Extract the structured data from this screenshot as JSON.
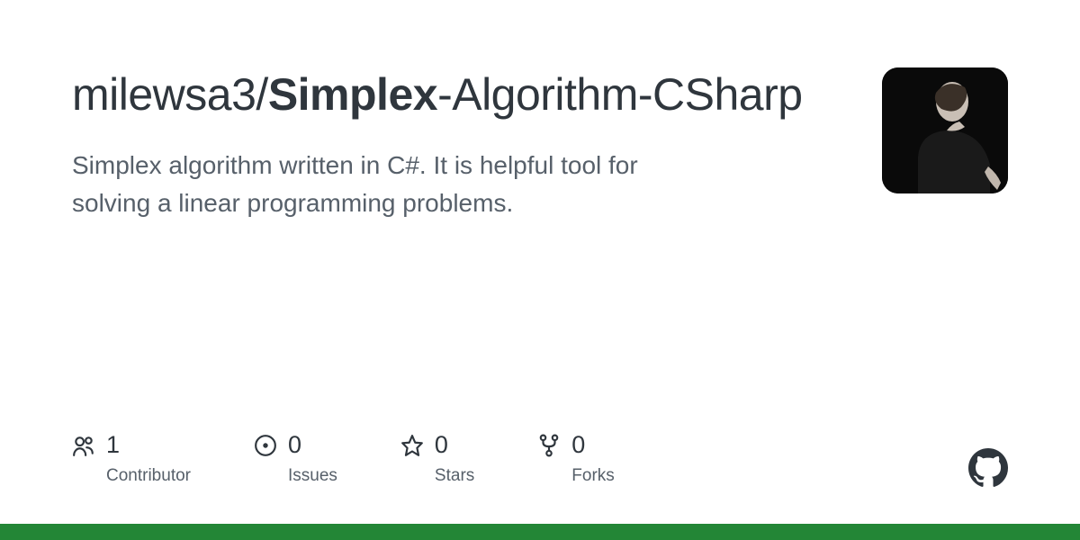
{
  "repo": {
    "owner": "milewsa3",
    "separator": "/",
    "name_bold": "Simplex",
    "name_rest": "-Algorithm-CSharp"
  },
  "description": "Simplex algorithm written in C#. It is helpful tool for solving a linear programming problems.",
  "stats": {
    "contributors": {
      "value": "1",
      "label": "Contributor"
    },
    "issues": {
      "value": "0",
      "label": "Issues"
    },
    "stars": {
      "value": "0",
      "label": "Stars"
    },
    "forks": {
      "value": "0",
      "label": "Forks"
    }
  },
  "colors": {
    "language_bar": "#238636"
  }
}
